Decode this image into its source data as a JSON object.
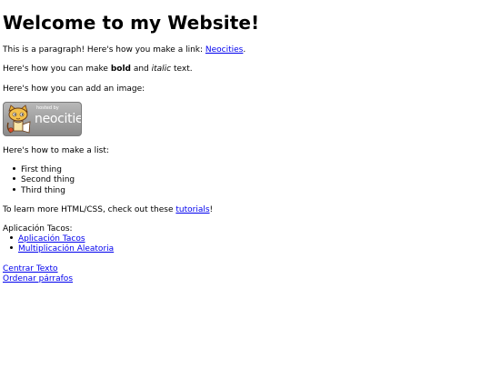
{
  "heading": "Welcome to my Website!",
  "p1": {
    "before": "This is a paragraph! Here's how you make a link: ",
    "link": "Neocities",
    "after": "."
  },
  "p2": {
    "before": "Here's how you can make ",
    "bold": "bold",
    "mid": " and ",
    "italic": "italic",
    "after": " text."
  },
  "p3": "Here's how you can add an image:",
  "badge": {
    "hosted_text": "hosted by",
    "brand_text": "neocities"
  },
  "p4": "Here's how to make a list:",
  "list": [
    "First thing",
    "Second thing",
    "Third thing"
  ],
  "p5": {
    "before": "To learn more HTML/CSS, check out these ",
    "link": "tutorials",
    "after": "!"
  },
  "apps_label": "Aplicación Tacos:",
  "apps": [
    "Aplicación Tacos",
    "Multiplicación Aleatoria"
  ],
  "links": [
    "Centrar Texto",
    "Ordenar párrafos"
  ]
}
